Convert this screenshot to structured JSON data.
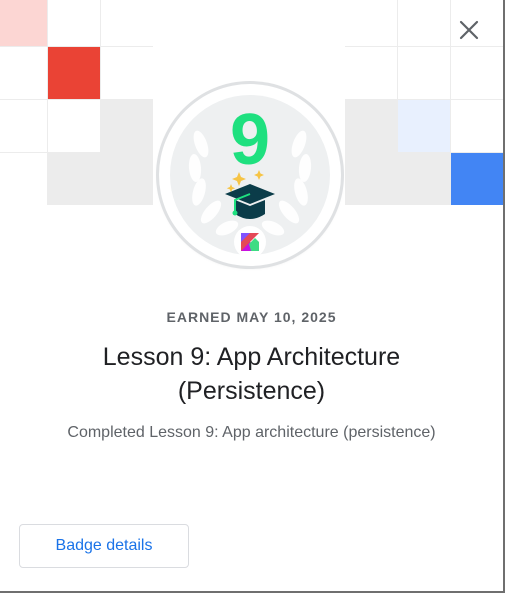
{
  "dialog": {
    "earned_label": "EARNED MAY 10, 2025",
    "title": "Lesson 9: App Architecture (Persistence)",
    "description": "Completed Lesson 9: App architecture (persistence)",
    "details_button": "Badge details",
    "close_icon": "close-icon"
  },
  "badge": {
    "number": "9",
    "number_color": "#1ee07f",
    "icons": [
      "laurel-wreath-icon",
      "graduation-cap-icon",
      "sparkle-icon",
      "kotlin-logo-icon"
    ]
  },
  "decor": {
    "left_grid_colors": [
      "#fcd6d3",
      "#ea4335"
    ],
    "right_grid_colors": [
      "#e8f0fe",
      "#4285f4"
    ]
  }
}
